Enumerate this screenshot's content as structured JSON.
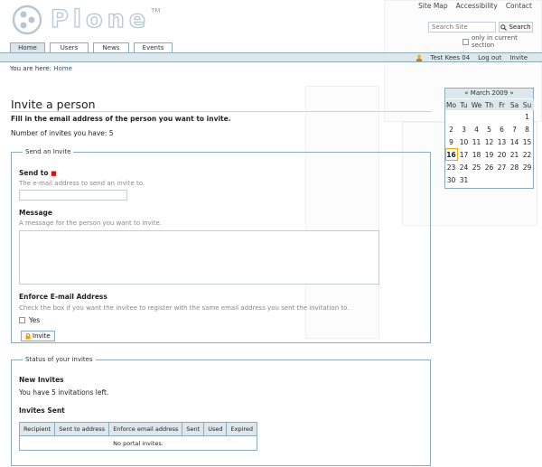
{
  "header": {
    "logo_text": "Plone",
    "logo_tm": "TM",
    "site_actions": [
      "Site Map",
      "Accessibility",
      "Contact"
    ],
    "search": {
      "placeholder": "Search Site",
      "button_label": "Search",
      "scope_label": "only in current section"
    }
  },
  "tabs": [
    {
      "label": "Home",
      "active": true
    },
    {
      "label": "Users",
      "active": false
    },
    {
      "label": "News",
      "active": false
    },
    {
      "label": "Events",
      "active": false
    }
  ],
  "personal_bar": {
    "user": "Test Kees 04",
    "logout": "Log out",
    "invite": "Invite"
  },
  "breadcrumbs": {
    "prefix": "You are here:",
    "home": "Home"
  },
  "calendar": {
    "month_label": "« March 2009 »",
    "days_of_week": [
      "Mo",
      "Tu",
      "We",
      "Th",
      "Fr",
      "Sa",
      "Su"
    ],
    "leading_blanks": 6,
    "days": [
      "1",
      "2",
      "3",
      "4",
      "5",
      "6",
      "7",
      "8",
      "9",
      "10",
      "11",
      "12",
      "13",
      "14",
      "15",
      "16",
      "17",
      "18",
      "19",
      "20",
      "21",
      "22",
      "23",
      "24",
      "25",
      "26",
      "27",
      "28",
      "29",
      "30",
      "31"
    ],
    "today": "16"
  },
  "main": {
    "title": "Invite a person",
    "description": "Fill in the email address of the person you want to invite.",
    "invites_count": "Number of invites you have: 5",
    "send_form": {
      "legend": "Send an Invite",
      "send_to_label": "Send to",
      "send_to_help": "The e-mail address to send an invite to.",
      "message_label": "Message",
      "message_help": "A message for the person you want to invite.",
      "enforce_label": "Enforce E-mail Address",
      "enforce_help": "Check the box if you want the invitee to register with the same email address you sent the invitation to.",
      "yes_label": "Yes",
      "invite_button": "Invite"
    },
    "status": {
      "legend": "Status of your invites",
      "new_heading": "New Invites",
      "new_text": "You have 5 invitations left.",
      "sent_heading": "Invites Sent",
      "table_headers": [
        "Recipient",
        "Sent to address",
        "Enforce email address",
        "Sent",
        "Used",
        "Expired"
      ],
      "empty_text": "No portal invites."
    }
  },
  "colors": {
    "border": "#8cacbb",
    "bar_bg": "#dee7ec",
    "link": "#205c90",
    "today_outline": "#ffa500",
    "required": "#ff0000"
  }
}
